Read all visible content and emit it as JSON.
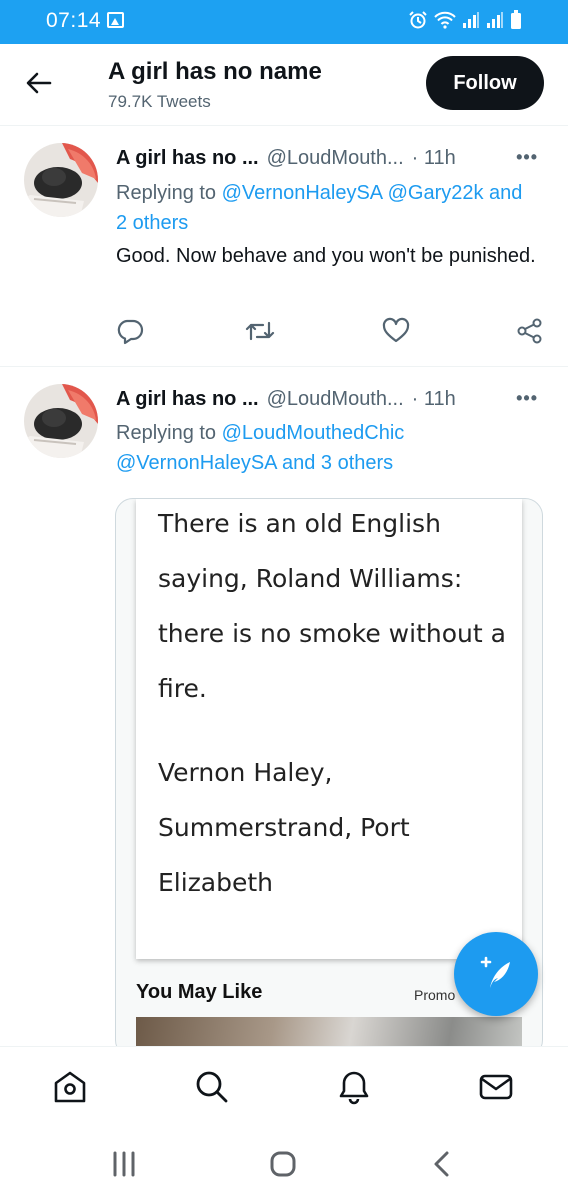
{
  "status_bar": {
    "time": "07:14",
    "color": "#1da1f2"
  },
  "header": {
    "title": "A girl has no name",
    "subtitle": "79.7K Tweets",
    "follow_label": "Follow"
  },
  "tweets": [
    {
      "name": "A girl has no ...",
      "handle": "@LoudMouth...",
      "time": "· 11h",
      "more": "•••",
      "replying_prefix": "Replying to",
      "mention1": "@VernonHaleySA",
      "mention2": "@Gary22k",
      "others": "and 2 others",
      "text": "Good. Now behave and you won't be punished.",
      "actions": [
        "reply-icon",
        "retweet-icon",
        "like-icon",
        "share-icon"
      ]
    },
    {
      "name": "A girl has no ...",
      "handle": "@LoudMouth...",
      "time": "· 11h",
      "more": "•••",
      "replying_prefix": "Replying to",
      "mention1": "@LoudMouthedChic",
      "mention2": "@VernonHaleySA",
      "others": "and 3 others",
      "card": {
        "lines": [
          "There is an old English",
          "saying, Roland Williams:",
          "there is no smoke without a",
          "fire.",
          "Vernon Haley,",
          "Summerstrand, Port",
          "Elizabeth"
        ],
        "section_title": "You May Like",
        "promo_label": "Promo"
      }
    }
  ],
  "bottom_nav": [
    "home-icon",
    "search-icon",
    "notifications-icon",
    "messages-icon"
  ],
  "system_nav": [
    "recent-apps-icon",
    "home-button-icon",
    "back-icon"
  ],
  "colors": {
    "accent": "#1d9bf0",
    "text": "#0f1419",
    "muted": "#536471"
  }
}
